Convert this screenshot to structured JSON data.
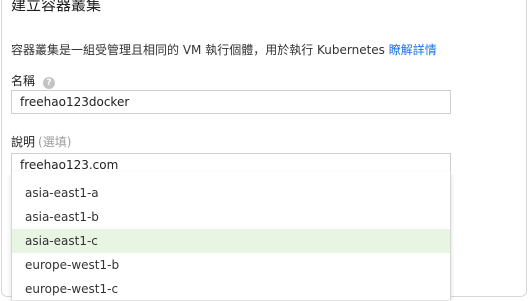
{
  "dialog": {
    "title": "建立容器叢集",
    "description": "容器叢集是一組受管理且相同的 VM 執行個體，用於執行 Kubernetes",
    "learn_more": "瞭解詳情"
  },
  "name_field": {
    "label": "名稱",
    "help_icon": "question-icon",
    "value": "freehao123docker"
  },
  "description_field": {
    "label": "說明",
    "optional": "(選填)",
    "value": "freehao123.com"
  },
  "zone_dropdown": {
    "options": [
      "asia-east1-a",
      "asia-east1-b",
      "asia-east1-c",
      "europe-west1-b",
      "europe-west1-c"
    ],
    "selected": "asia-east1-c"
  },
  "colors": {
    "link": "#1a73e8",
    "selected_bg": "#e8f5e3"
  }
}
